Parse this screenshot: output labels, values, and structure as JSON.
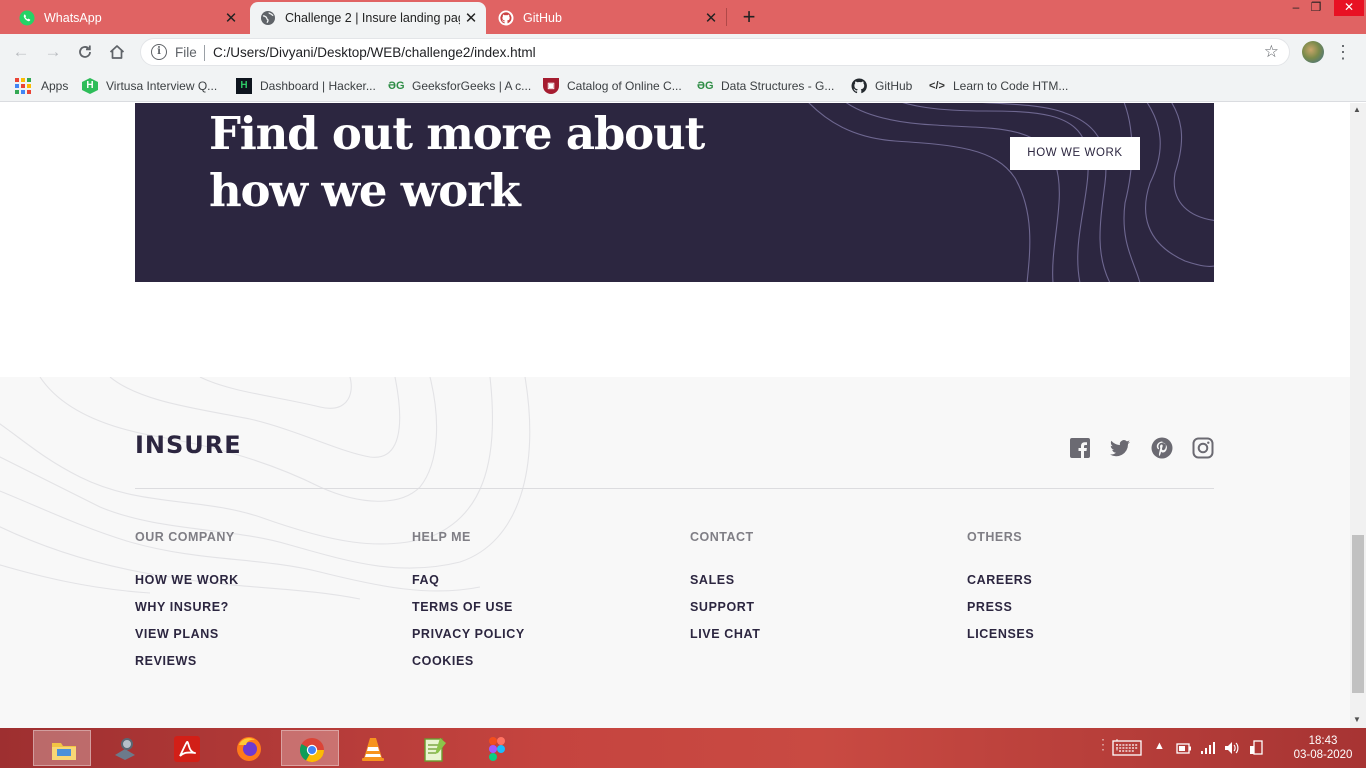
{
  "browser": {
    "tabs": [
      {
        "title": "WhatsApp",
        "icon": "whatsapp-icon",
        "active": false
      },
      {
        "title": "Challenge 2 | Insure landing page",
        "icon": "globe-icon",
        "active": true
      },
      {
        "title": "GitHub",
        "icon": "github-icon",
        "active": false
      }
    ],
    "url_scheme": "File",
    "url": "C:/Users/Divyani/Desktop/WEB/challenge2/index.html",
    "bookmarks": [
      {
        "label": "Apps",
        "icon": "apps-grid-icon"
      },
      {
        "label": "Virtusa Interview Q...",
        "icon": "hackerearth-icon"
      },
      {
        "label": "Dashboard | Hacker...",
        "icon": "hackerrank-icon"
      },
      {
        "label": "GeeksforGeeks | A c...",
        "icon": "geeksforgeeks-icon"
      },
      {
        "label": "Catalog of Online C...",
        "icon": "harvard-shield-icon"
      },
      {
        "label": "Data Structures - G...",
        "icon": "geeksforgeeks-icon"
      },
      {
        "label": "GitHub",
        "icon": "github-icon"
      },
      {
        "label": "Learn to Code HTM...",
        "icon": "code-brackets-icon"
      }
    ]
  },
  "page": {
    "cta": {
      "heading": "Find out more about how we work",
      "button": "HOW WE WORK"
    },
    "footer": {
      "logo": "INSURE",
      "socials": [
        "facebook-icon",
        "twitter-icon",
        "pinterest-icon",
        "instagram-icon"
      ],
      "columns": [
        {
          "heading": "OUR COMPANY",
          "links": [
            "HOW WE WORK",
            "WHY INSURE?",
            "VIEW PLANS",
            "REVIEWS"
          ]
        },
        {
          "heading": "HELP ME",
          "links": [
            "FAQ",
            "TERMS OF USE",
            "PRIVACY POLICY",
            "COOKIES"
          ]
        },
        {
          "heading": "CONTACT",
          "links": [
            "SALES",
            "SUPPORT",
            "LIVE CHAT"
          ]
        },
        {
          "heading": "OTHERS",
          "links": [
            "CAREERS",
            "PRESS",
            "LICENSES"
          ]
        }
      ]
    },
    "colors": {
      "primary_dark": "#2c2640",
      "footer_bg": "#f8f8f8",
      "muted_text": "#7f7e85"
    }
  },
  "taskbar": {
    "apps": [
      "file-explorer-icon",
      "settings-app-icon",
      "acrobat-icon",
      "firefox-icon",
      "chrome-icon",
      "vlc-icon",
      "notepadpp-icon",
      "figma-icon"
    ],
    "time": "18:43",
    "date": "03-08-2020"
  }
}
